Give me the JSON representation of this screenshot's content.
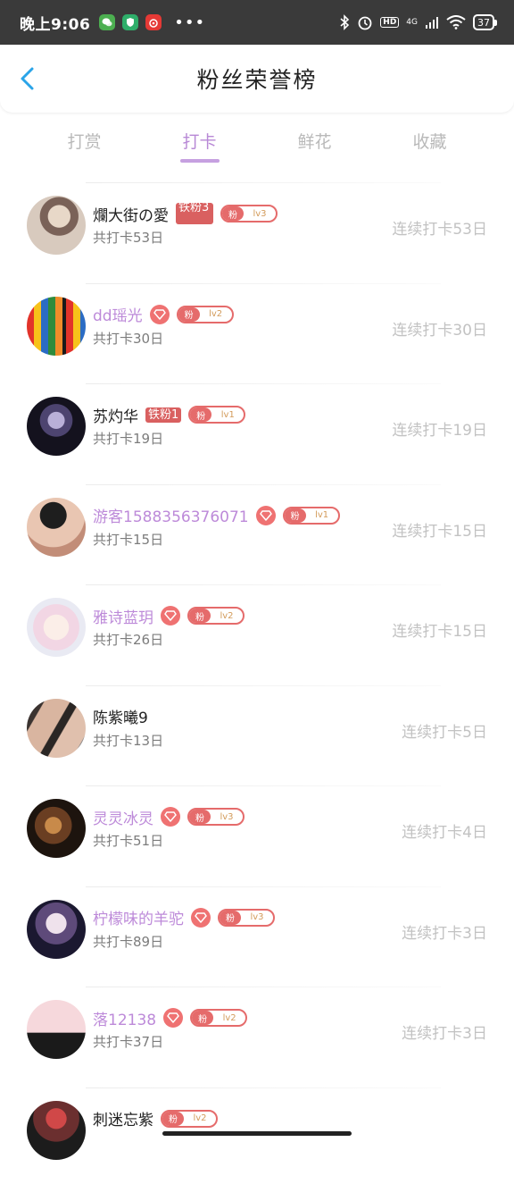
{
  "status_bar": {
    "time": "晚上9:06",
    "more": "•••",
    "network": "4G",
    "hd": "HD",
    "battery": "37"
  },
  "header": {
    "title": "粉丝荣誉榜"
  },
  "tabs": [
    {
      "label": "打赏",
      "active": false
    },
    {
      "label": "打卡",
      "active": true
    },
    {
      "label": "鲜花",
      "active": false
    },
    {
      "label": "收藏",
      "active": false
    }
  ],
  "fan_badge_label": "粉",
  "rows": [
    {
      "name": "爛大街の愛",
      "vip": false,
      "tie": "铁粉3",
      "level": "lv3",
      "count": "共打卡53日",
      "streak": "连续打卡53日"
    },
    {
      "name": "dd瑶光",
      "vip": true,
      "tie": "",
      "level": "lv2",
      "count": "共打卡30日",
      "streak": "连续打卡30日"
    },
    {
      "name": "苏灼华",
      "vip": false,
      "tie": "铁粉1",
      "level": "lv1",
      "count": "共打卡19日",
      "streak": "连续打卡19日"
    },
    {
      "name": "游客1588356376071",
      "vip": true,
      "tie": "",
      "level": "lv1",
      "count": "共打卡15日",
      "streak": "连续打卡15日"
    },
    {
      "name": "雅诗蓝玥",
      "vip": true,
      "tie": "",
      "level": "lv2",
      "count": "共打卡26日",
      "streak": "连续打卡15日"
    },
    {
      "name": "陈紫曦9",
      "vip": false,
      "tie": "",
      "level": "",
      "count": "共打卡13日",
      "streak": "连续打卡5日"
    },
    {
      "name": "灵灵冰灵",
      "vip": true,
      "tie": "",
      "level": "lv3",
      "count": "共打卡51日",
      "streak": "连续打卡4日"
    },
    {
      "name": "柠檬味的羊驼",
      "vip": true,
      "tie": "",
      "level": "lv3",
      "count": "共打卡89日",
      "streak": "连续打卡3日"
    },
    {
      "name": "落12138",
      "vip": true,
      "tie": "",
      "level": "lv2",
      "count": "共打卡37日",
      "streak": "连续打卡3日"
    },
    {
      "name": "刺迷忘紫",
      "vip": false,
      "tie": "",
      "level": "lv2",
      "count": "",
      "streak": ""
    }
  ],
  "colors": {
    "accent": "#b889d6",
    "badge_red": "#e56b6b",
    "muted": "#c2c2c2"
  }
}
